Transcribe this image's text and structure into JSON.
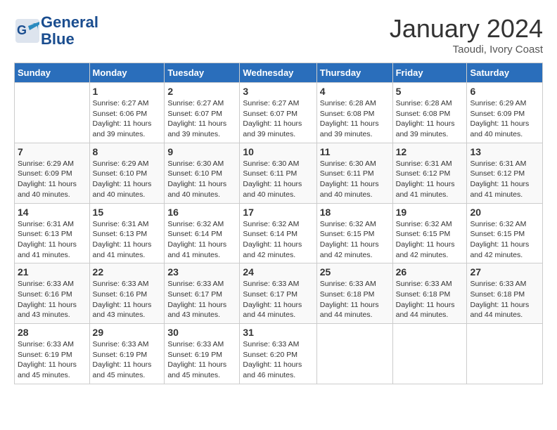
{
  "header": {
    "logo_line1": "General",
    "logo_line2": "Blue",
    "month": "January 2024",
    "location": "Taoudi, Ivory Coast"
  },
  "weekdays": [
    "Sunday",
    "Monday",
    "Tuesday",
    "Wednesday",
    "Thursday",
    "Friday",
    "Saturday"
  ],
  "weeks": [
    [
      {
        "day": "",
        "sunrise": "",
        "sunset": "",
        "daylight": ""
      },
      {
        "day": "1",
        "sunrise": "Sunrise: 6:27 AM",
        "sunset": "Sunset: 6:06 PM",
        "daylight": "Daylight: 11 hours and 39 minutes."
      },
      {
        "day": "2",
        "sunrise": "Sunrise: 6:27 AM",
        "sunset": "Sunset: 6:07 PM",
        "daylight": "Daylight: 11 hours and 39 minutes."
      },
      {
        "day": "3",
        "sunrise": "Sunrise: 6:27 AM",
        "sunset": "Sunset: 6:07 PM",
        "daylight": "Daylight: 11 hours and 39 minutes."
      },
      {
        "day": "4",
        "sunrise": "Sunrise: 6:28 AM",
        "sunset": "Sunset: 6:08 PM",
        "daylight": "Daylight: 11 hours and 39 minutes."
      },
      {
        "day": "5",
        "sunrise": "Sunrise: 6:28 AM",
        "sunset": "Sunset: 6:08 PM",
        "daylight": "Daylight: 11 hours and 39 minutes."
      },
      {
        "day": "6",
        "sunrise": "Sunrise: 6:29 AM",
        "sunset": "Sunset: 6:09 PM",
        "daylight": "Daylight: 11 hours and 40 minutes."
      }
    ],
    [
      {
        "day": "7",
        "sunrise": "Sunrise: 6:29 AM",
        "sunset": "Sunset: 6:09 PM",
        "daylight": "Daylight: 11 hours and 40 minutes."
      },
      {
        "day": "8",
        "sunrise": "Sunrise: 6:29 AM",
        "sunset": "Sunset: 6:10 PM",
        "daylight": "Daylight: 11 hours and 40 minutes."
      },
      {
        "day": "9",
        "sunrise": "Sunrise: 6:30 AM",
        "sunset": "Sunset: 6:10 PM",
        "daylight": "Daylight: 11 hours and 40 minutes."
      },
      {
        "day": "10",
        "sunrise": "Sunrise: 6:30 AM",
        "sunset": "Sunset: 6:11 PM",
        "daylight": "Daylight: 11 hours and 40 minutes."
      },
      {
        "day": "11",
        "sunrise": "Sunrise: 6:30 AM",
        "sunset": "Sunset: 6:11 PM",
        "daylight": "Daylight: 11 hours and 40 minutes."
      },
      {
        "day": "12",
        "sunrise": "Sunrise: 6:31 AM",
        "sunset": "Sunset: 6:12 PM",
        "daylight": "Daylight: 11 hours and 41 minutes."
      },
      {
        "day": "13",
        "sunrise": "Sunrise: 6:31 AM",
        "sunset": "Sunset: 6:12 PM",
        "daylight": "Daylight: 11 hours and 41 minutes."
      }
    ],
    [
      {
        "day": "14",
        "sunrise": "Sunrise: 6:31 AM",
        "sunset": "Sunset: 6:13 PM",
        "daylight": "Daylight: 11 hours and 41 minutes."
      },
      {
        "day": "15",
        "sunrise": "Sunrise: 6:31 AM",
        "sunset": "Sunset: 6:13 PM",
        "daylight": "Daylight: 11 hours and 41 minutes."
      },
      {
        "day": "16",
        "sunrise": "Sunrise: 6:32 AM",
        "sunset": "Sunset: 6:14 PM",
        "daylight": "Daylight: 11 hours and 41 minutes."
      },
      {
        "day": "17",
        "sunrise": "Sunrise: 6:32 AM",
        "sunset": "Sunset: 6:14 PM",
        "daylight": "Daylight: 11 hours and 42 minutes."
      },
      {
        "day": "18",
        "sunrise": "Sunrise: 6:32 AM",
        "sunset": "Sunset: 6:15 PM",
        "daylight": "Daylight: 11 hours and 42 minutes."
      },
      {
        "day": "19",
        "sunrise": "Sunrise: 6:32 AM",
        "sunset": "Sunset: 6:15 PM",
        "daylight": "Daylight: 11 hours and 42 minutes."
      },
      {
        "day": "20",
        "sunrise": "Sunrise: 6:32 AM",
        "sunset": "Sunset: 6:15 PM",
        "daylight": "Daylight: 11 hours and 42 minutes."
      }
    ],
    [
      {
        "day": "21",
        "sunrise": "Sunrise: 6:33 AM",
        "sunset": "Sunset: 6:16 PM",
        "daylight": "Daylight: 11 hours and 43 minutes."
      },
      {
        "day": "22",
        "sunrise": "Sunrise: 6:33 AM",
        "sunset": "Sunset: 6:16 PM",
        "daylight": "Daylight: 11 hours and 43 minutes."
      },
      {
        "day": "23",
        "sunrise": "Sunrise: 6:33 AM",
        "sunset": "Sunset: 6:17 PM",
        "daylight": "Daylight: 11 hours and 43 minutes."
      },
      {
        "day": "24",
        "sunrise": "Sunrise: 6:33 AM",
        "sunset": "Sunset: 6:17 PM",
        "daylight": "Daylight: 11 hours and 44 minutes."
      },
      {
        "day": "25",
        "sunrise": "Sunrise: 6:33 AM",
        "sunset": "Sunset: 6:18 PM",
        "daylight": "Daylight: 11 hours and 44 minutes."
      },
      {
        "day": "26",
        "sunrise": "Sunrise: 6:33 AM",
        "sunset": "Sunset: 6:18 PM",
        "daylight": "Daylight: 11 hours and 44 minutes."
      },
      {
        "day": "27",
        "sunrise": "Sunrise: 6:33 AM",
        "sunset": "Sunset: 6:18 PM",
        "daylight": "Daylight: 11 hours and 44 minutes."
      }
    ],
    [
      {
        "day": "28",
        "sunrise": "Sunrise: 6:33 AM",
        "sunset": "Sunset: 6:19 PM",
        "daylight": "Daylight: 11 hours and 45 minutes."
      },
      {
        "day": "29",
        "sunrise": "Sunrise: 6:33 AM",
        "sunset": "Sunset: 6:19 PM",
        "daylight": "Daylight: 11 hours and 45 minutes."
      },
      {
        "day": "30",
        "sunrise": "Sunrise: 6:33 AM",
        "sunset": "Sunset: 6:19 PM",
        "daylight": "Daylight: 11 hours and 45 minutes."
      },
      {
        "day": "31",
        "sunrise": "Sunrise: 6:33 AM",
        "sunset": "Sunset: 6:20 PM",
        "daylight": "Daylight: 11 hours and 46 minutes."
      },
      {
        "day": "",
        "sunrise": "",
        "sunset": "",
        "daylight": ""
      },
      {
        "day": "",
        "sunrise": "",
        "sunset": "",
        "daylight": ""
      },
      {
        "day": "",
        "sunrise": "",
        "sunset": "",
        "daylight": ""
      }
    ]
  ]
}
